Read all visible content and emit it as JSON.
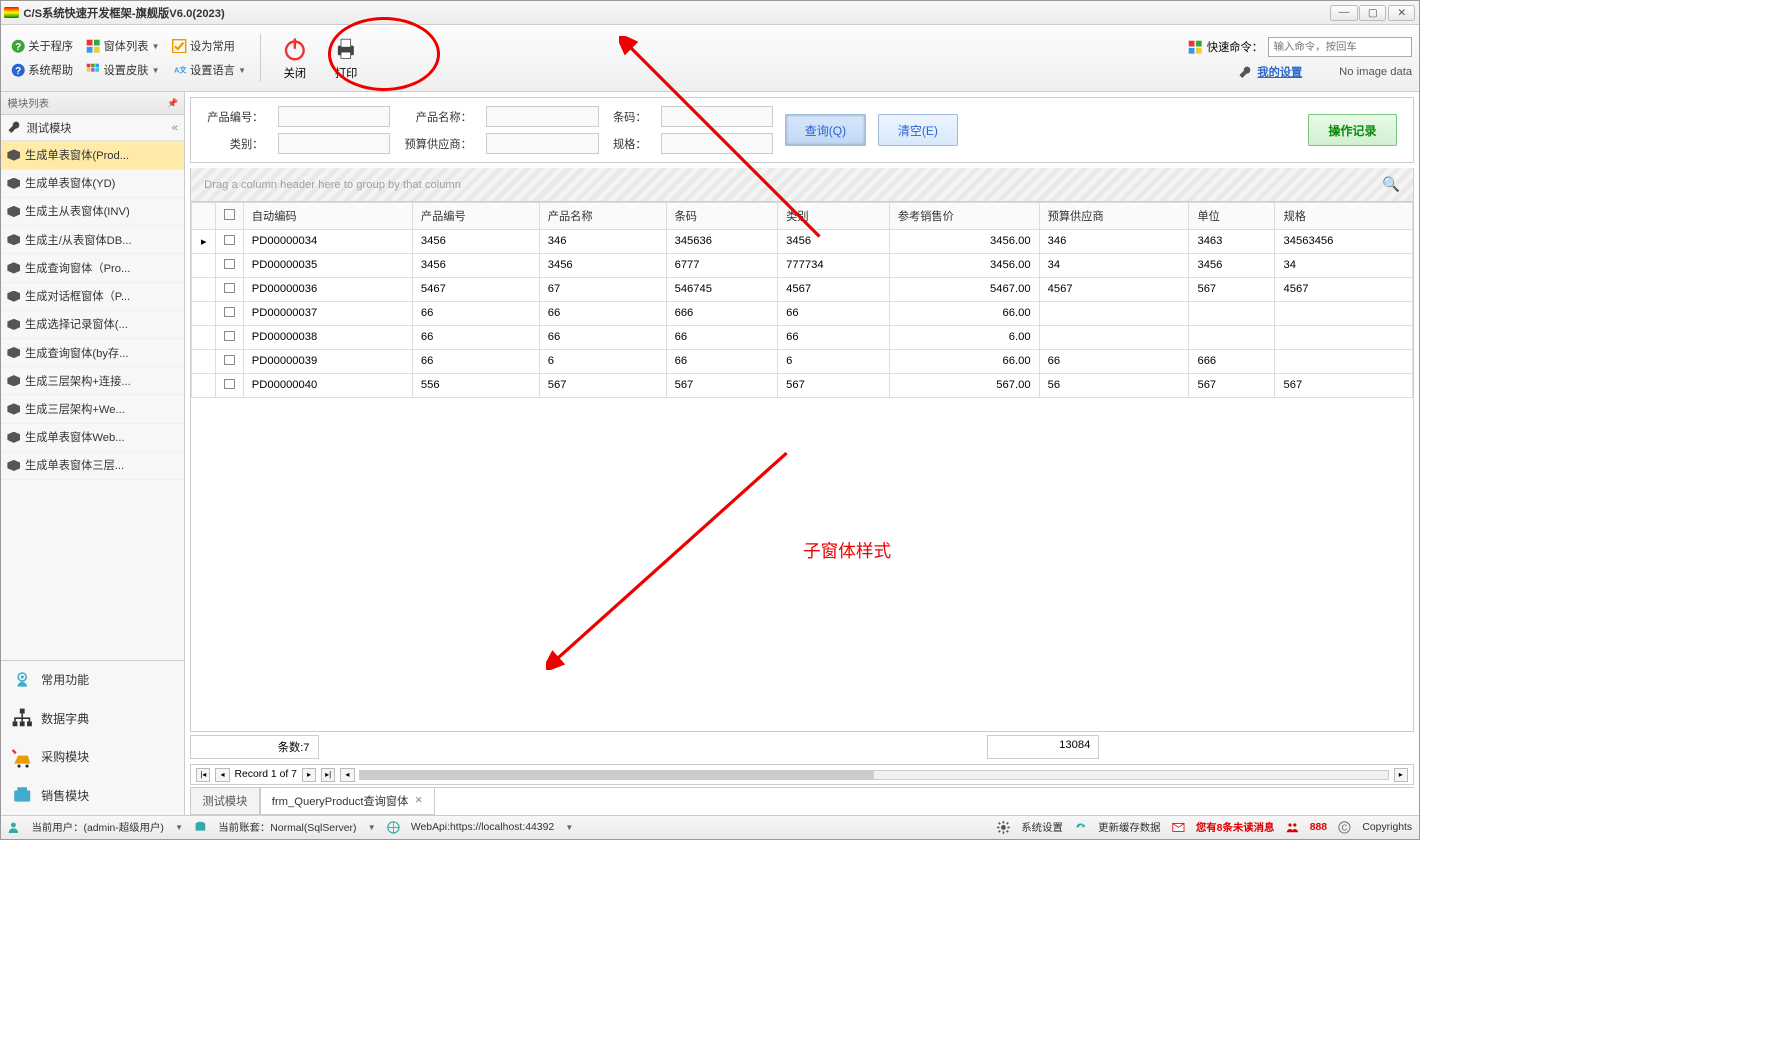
{
  "window": {
    "title": "C/S系统快速开发框架-旗舰版V6.0(2023)"
  },
  "toolbar": {
    "about": "关于程序",
    "form_list": "窗体列表",
    "set_default": "设为常用",
    "sys_help": "系统帮助",
    "set_skin": "设置皮肤",
    "set_lang": "设置语言",
    "close": "关闭",
    "print": "打印",
    "quick_cmd_label": "快速命令：",
    "quick_cmd_placeholder": "输入命令，按回车",
    "my_settings": "我的设置",
    "no_image": "No image data"
  },
  "sidebar": {
    "header": "模块列表",
    "section": "测试模块",
    "items": [
      "生成单表窗体(Prod...",
      "生成单表窗体(YD)",
      "生成主从表窗体(INV)",
      "生成主/从表窗体DB...",
      "生成查询窗体（Pro...",
      "生成对话框窗体（P...",
      "生成选择记录窗体(...",
      "生成查询窗体(by存...",
      "生成三层架构+连接...",
      "生成三层架构+We...",
      "生成单表窗体Web...",
      "生成单表窗体三层..."
    ],
    "modules": [
      "常用功能",
      "数据字典",
      "采购模块",
      "销售模块"
    ]
  },
  "search": {
    "labels": {
      "code": "产品编号：",
      "name": "产品名称：",
      "barcode": "条码：",
      "category": "类别：",
      "supplier": "预算供应商：",
      "spec": "规格："
    },
    "btn_query": "查询(Q)",
    "btn_clear": "清空(E)",
    "btn_log": "操作记录"
  },
  "grid": {
    "group_hint": "Drag a column header here to group by that column",
    "headers": [
      "自动编码",
      "产品编号",
      "产品名称",
      "条码",
      "类别",
      "参考销售价",
      "预算供应商",
      "单位",
      "规格"
    ],
    "rows": [
      {
        "auto": "PD00000034",
        "code": "3456",
        "name": "346",
        "barcode": "345636",
        "cat": "3456",
        "price": "3456.00",
        "supplier": "346",
        "unit": "3463",
        "spec": "34563456"
      },
      {
        "auto": "PD00000035",
        "code": "3456",
        "name": "3456",
        "barcode": "6777",
        "cat": "777734",
        "price": "3456.00",
        "supplier": "34",
        "unit": "3456",
        "spec": "34"
      },
      {
        "auto": "PD00000036",
        "code": "5467",
        "name": "67",
        "barcode": "546745",
        "cat": "4567",
        "price": "5467.00",
        "supplier": "4567",
        "unit": "567",
        "spec": "4567"
      },
      {
        "auto": "PD00000037",
        "code": "66",
        "name": "66",
        "barcode": "666",
        "cat": "66",
        "price": "66.00",
        "supplier": "",
        "unit": "",
        "spec": ""
      },
      {
        "auto": "PD00000038",
        "code": "66",
        "name": "66",
        "barcode": "66",
        "cat": "66",
        "price": "6.00",
        "supplier": "",
        "unit": "",
        "spec": ""
      },
      {
        "auto": "PD00000039",
        "code": "66",
        "name": "6",
        "barcode": "66",
        "cat": "6",
        "price": "66.00",
        "supplier": "66",
        "unit": "666",
        "spec": ""
      },
      {
        "auto": "PD00000040",
        "code": "556",
        "name": "567",
        "barcode": "567",
        "cat": "567",
        "price": "567.00",
        "supplier": "56",
        "unit": "567",
        "spec": "567"
      }
    ],
    "count_label": "条数:7",
    "sum_price": "13084",
    "paginator": "Record 1 of 7"
  },
  "tabs": {
    "tab1": "测试模块",
    "tab2": "frm_QueryProduct查询窗体"
  },
  "status": {
    "user": "当前用户：(admin-超级用户)",
    "account": "当前账套：Normal(SqlServer)",
    "webapi": "WebApi:https://localhost:44392",
    "sys_settings": "系统设置",
    "refresh_cache": "更新缓存数据",
    "unread": "您有8条未读消息",
    "online": "888",
    "copyrights": "Copyrights"
  },
  "annotation": {
    "child_form": "子窗体样式"
  }
}
